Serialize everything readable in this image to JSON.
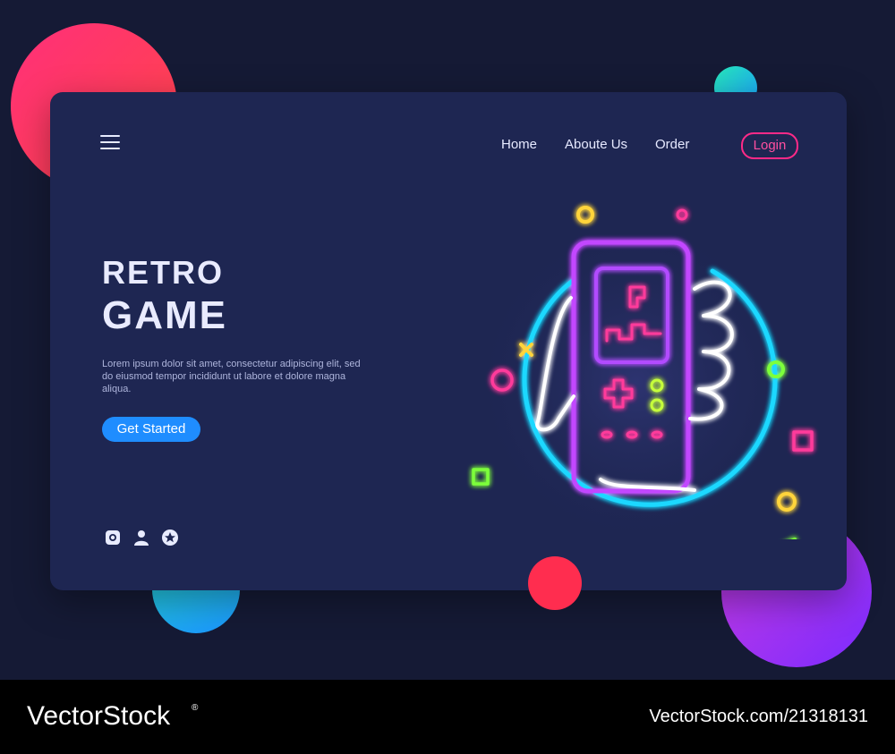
{
  "nav": {
    "home": "Home",
    "about": "Aboute Us",
    "order": "Order",
    "login": "Login"
  },
  "hero": {
    "title_line1": "RETRO",
    "title_line2": "GAME",
    "description": "Lorem ipsum dolor sit amet, consectetur adipiscing elit, sed do eiusmod tempor incididunt ut labore et dolore magna aliqua.",
    "cta": "Get Started"
  },
  "socials": [
    "instagram-icon",
    "user-icon",
    "star-icon"
  ],
  "watermark": {
    "brand": "VectorStock",
    "image_id": "VectorStock.com/21318131"
  },
  "colors": {
    "background": "#151a35",
    "card": "#1e2652",
    "accent_pink": "#ff2a88",
    "cta_blue": "#1f8dff"
  }
}
